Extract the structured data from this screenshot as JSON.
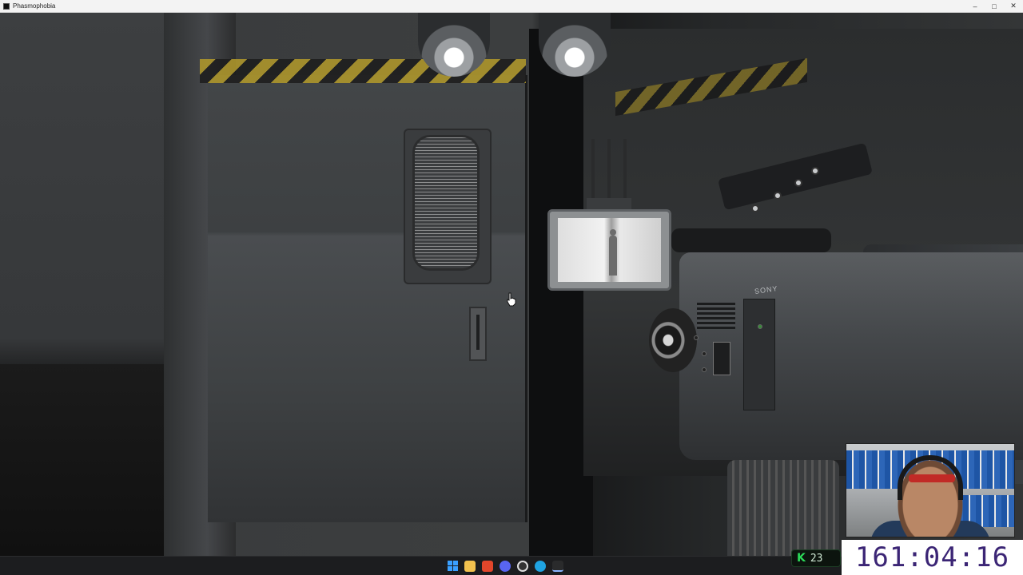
{
  "window": {
    "title": "Phasmophobia",
    "controls": {
      "minimize": "–",
      "maximize": "□",
      "close": "✕"
    }
  },
  "scene": {
    "camera_brand": "SONY"
  },
  "taskbar": {
    "icons": [
      "start-icon",
      "file-explorer-icon",
      "brave-browser-icon",
      "discord-icon",
      "obs-icon",
      "edge-icon",
      "game-icon"
    ]
  },
  "overlay": {
    "badge_label": "K",
    "badge_count": "23",
    "timer": "161:04:16"
  },
  "colors": {
    "titlebar": "#f3f3f3",
    "taskbar": "#1c1d1f",
    "timer_text": "#3b2575",
    "badge_accent": "#2cdc5a"
  }
}
